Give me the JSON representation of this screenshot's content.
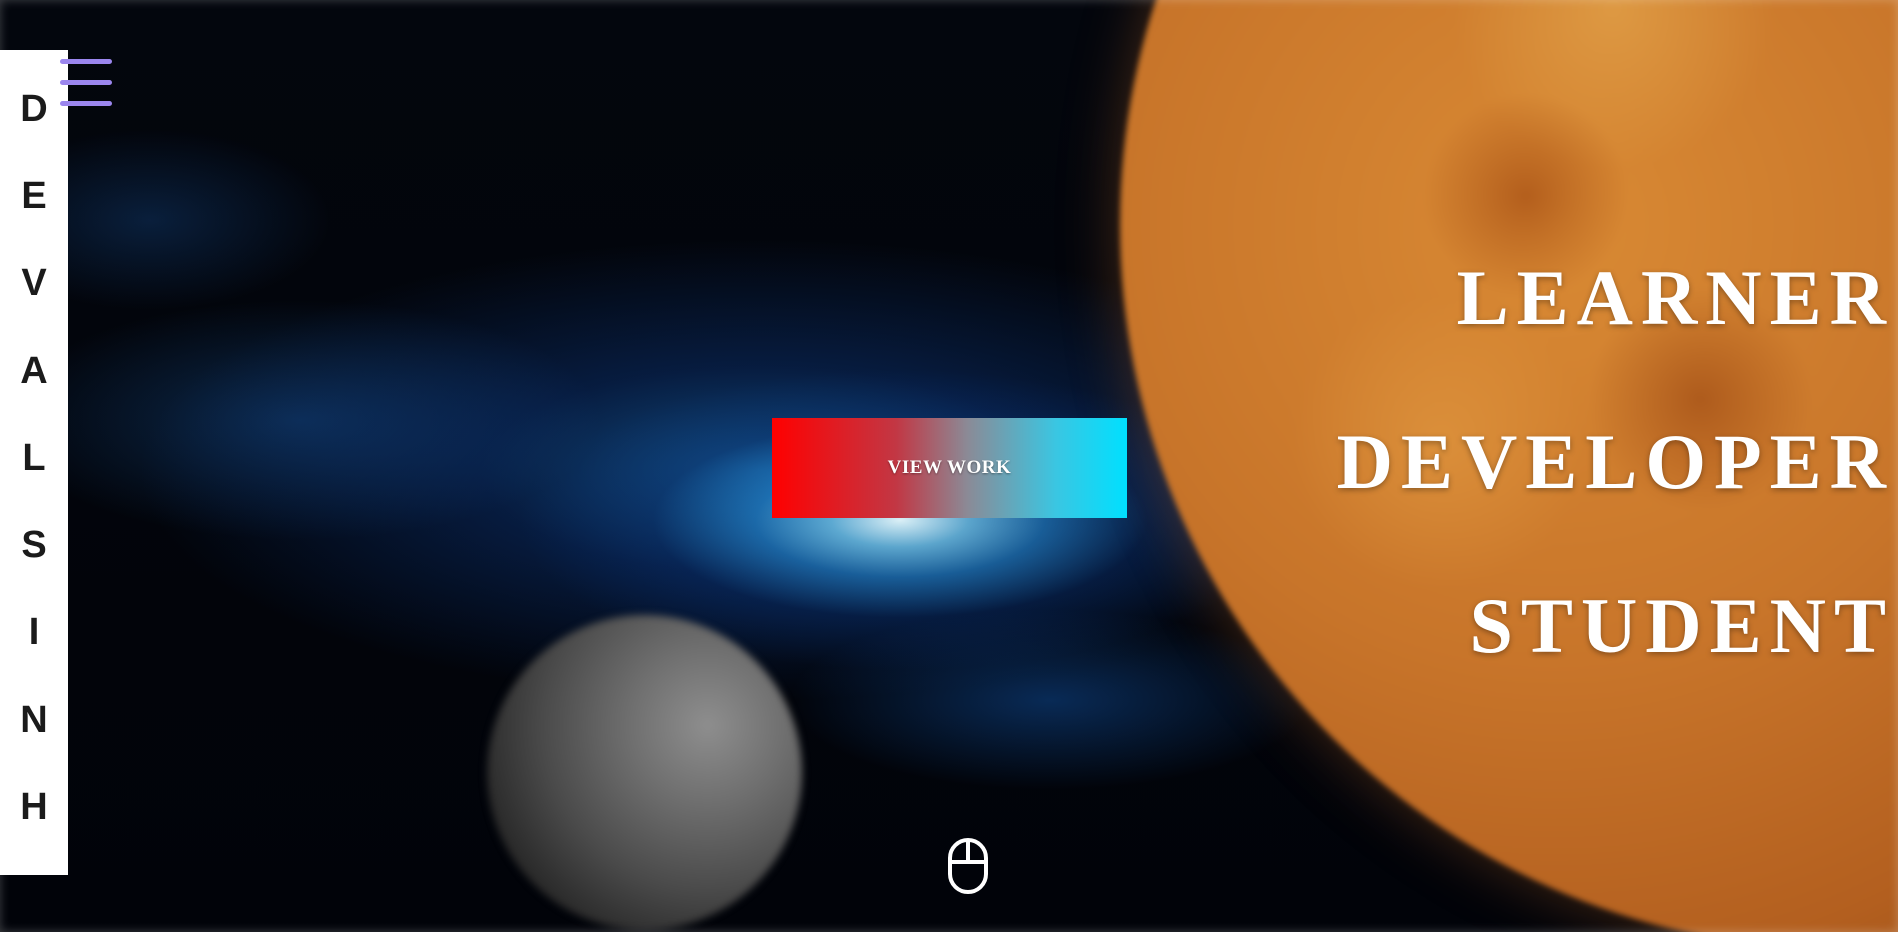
{
  "brand": {
    "letters": [
      "D",
      "E",
      "V",
      "A",
      "L",
      "S",
      "I",
      "N",
      "H"
    ]
  },
  "menu": {
    "icon": "hamburger-menu-icon",
    "color": "#9b86ee"
  },
  "hero": {
    "cta_label": "VIEW WORK",
    "cta_gradient": [
      "#ff0000",
      "#00e0ff"
    ],
    "roles": [
      "LEARNER",
      "DEVELOPER",
      "STUDENT"
    ]
  },
  "scroll_hint": {
    "icon": "mouse-scroll-icon"
  }
}
